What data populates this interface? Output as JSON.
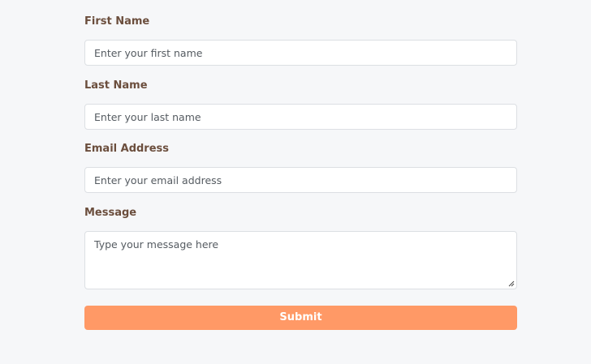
{
  "form": {
    "first_name": {
      "label": "First Name",
      "placeholder": "Enter your first name",
      "value": ""
    },
    "last_name": {
      "label": "Last Name",
      "placeholder": "Enter your last name",
      "value": ""
    },
    "email": {
      "label": "Email Address",
      "placeholder": "Enter your email address",
      "value": ""
    },
    "message": {
      "label": "Message",
      "placeholder": "Type your message here",
      "value": ""
    },
    "submit_label": "Submit"
  },
  "colors": {
    "background": "#f6f7f9",
    "label": "#6b4e3d",
    "field_border": "#dcdfe3",
    "submit_button": "#ff9966"
  }
}
